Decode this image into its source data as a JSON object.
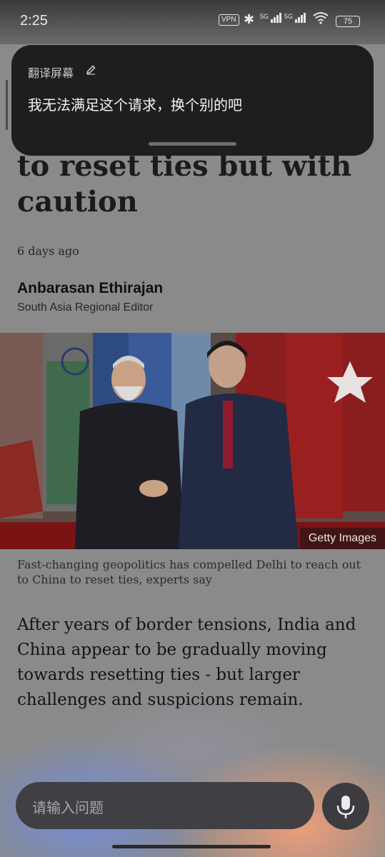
{
  "status_bar": {
    "time": "2:25",
    "vpn": "VPN",
    "signal1_label": "5G",
    "signal2_label": "5G",
    "battery": "75"
  },
  "overlay": {
    "title": "翻译屏幕",
    "message": "我无法满足这个请求，换个别的吧"
  },
  "article": {
    "headline": "to reset ties but with caution",
    "date": "6 days ago",
    "author": "Anbarasan Ethirajan",
    "author_role": "South Asia Regional Editor",
    "image_credit": "Getty Images",
    "caption": "Fast-changing geopolitics has compelled Delhi to reach out to China to reset ties, experts say",
    "lede": "After years of border tensions, India and China appear to be gradually moving towards resetting ties - but larger challenges and suspicions remain."
  },
  "assistant": {
    "input_placeholder": "请输入问题"
  },
  "icons": {
    "edit": "pencil-icon",
    "mic": "microphone-icon",
    "bluetooth": "bluetooth-icon",
    "wifi": "wifi-icon"
  }
}
